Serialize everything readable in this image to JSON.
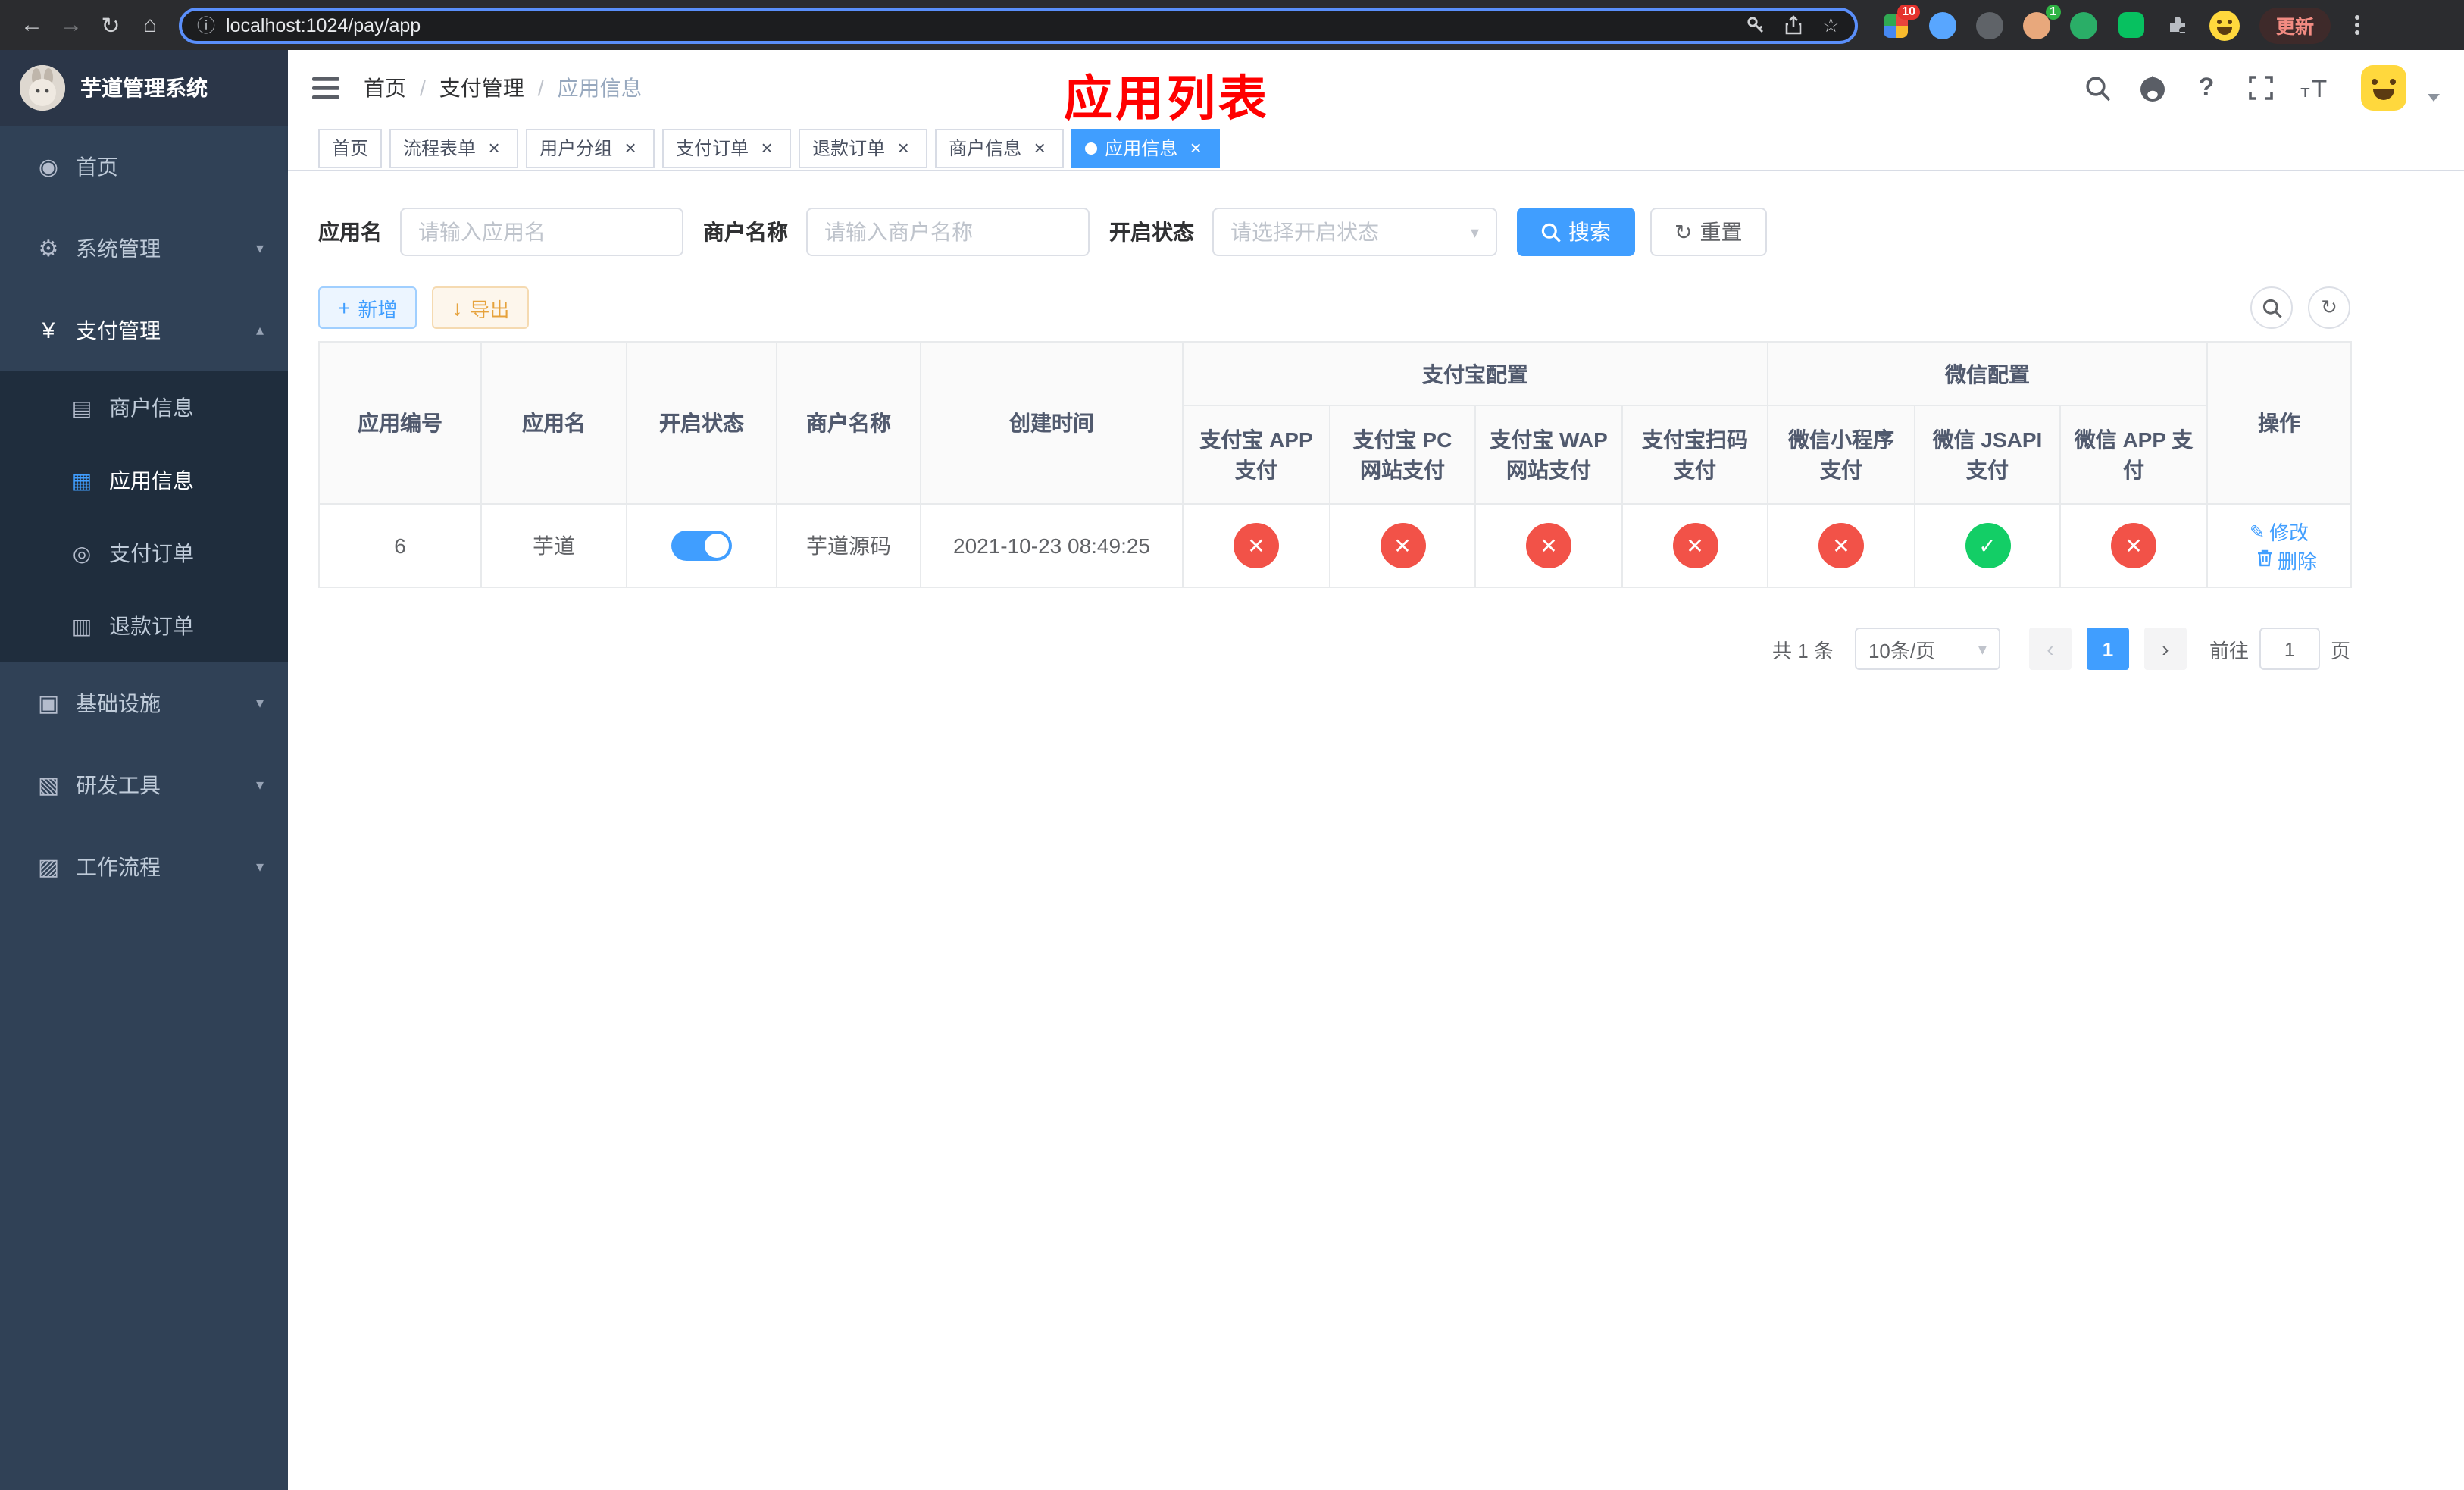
{
  "browser": {
    "url": "localhost:1024/pay/app",
    "update_label": "更新",
    "extensions_badge": "10",
    "profile_badge": "1"
  },
  "sidebar": {
    "title": "芋道管理系统",
    "menu": {
      "home": "首页",
      "system": "系统管理",
      "payment": "支付管理",
      "merchant_info": "商户信息",
      "app_info": "应用信息",
      "pay_order": "支付订单",
      "refund_order": "退款订单",
      "infrastructure": "基础设施",
      "dev_tools": "研发工具",
      "workflow": "工作流程"
    }
  },
  "navbar": {
    "breadcrumb": [
      "首页",
      "支付管理",
      "应用信息"
    ],
    "separator": "/",
    "annotation": "应用列表"
  },
  "tabs": [
    {
      "label": "首页"
    },
    {
      "label": "流程表单"
    },
    {
      "label": "用户分组"
    },
    {
      "label": "支付订单"
    },
    {
      "label": "退款订单"
    },
    {
      "label": "商户信息"
    },
    {
      "label": "应用信息"
    }
  ],
  "filters": {
    "app_name": {
      "label": "应用名",
      "placeholder": "请输入应用名"
    },
    "merchant_name": {
      "label": "商户名称",
      "placeholder": "请输入商户名称"
    },
    "status": {
      "label": "开启状态",
      "placeholder": "请选择开启状态"
    },
    "search": "搜索",
    "reset": "重置"
  },
  "toolbar": {
    "add": "新增",
    "export": "导出"
  },
  "table": {
    "headers": {
      "app_id": "应用编号",
      "app_name": "应用名",
      "status": "开启状态",
      "merchant_name": "商户名称",
      "create_time": "创建时间",
      "alipay_group": "支付宝配置",
      "wechat_group": "微信配置",
      "alipay_app": "支付宝 APP 支付",
      "alipay_pc": "支付宝 PC 网站支付",
      "alipay_wap": "支付宝 WAP 网站支付",
      "alipay_qr": "支付宝扫码支付",
      "wechat_lite": "微信小程序支付",
      "wechat_jsapi": "微信 JSAPI 支付",
      "wechat_app": "微信 APP 支付",
      "actions": "操作"
    },
    "row": {
      "app_id": "6",
      "app_name": "芋道",
      "status_on": true,
      "merchant_name": "芋道源码",
      "create_time": "2021-10-23 08:49:25",
      "alipay_app": "disabled",
      "alipay_pc": "disabled",
      "alipay_wap": "disabled",
      "alipay_qr": "disabled",
      "wechat_lite": "disabled",
      "wechat_jsapi": "enabled",
      "wechat_app": "disabled",
      "edit": "修改",
      "delete": "删除"
    }
  },
  "pagination": {
    "total": "共 1 条",
    "page_size": "10条/页",
    "page": "1",
    "goto": "前往",
    "goto_value": "1",
    "unit": "页"
  },
  "icons": {
    "back": "←",
    "forward": "→",
    "reload": "↻",
    "home": "⌂",
    "info": "ⓘ",
    "star": "☆",
    "close": "×",
    "check": "✓",
    "cross": "✕",
    "plus": "+",
    "download": "↓",
    "refresh": "↻",
    "edit": "✎",
    "help": "?",
    "prev": "‹",
    "next": "›",
    "caret_down": "▾",
    "caret_up": "▴",
    "menu_home": "◉",
    "menu_system": "⚙",
    "menu_payment": "¥",
    "menu_merchant": "▤",
    "menu_app": "▦",
    "menu_pay_order": "◎",
    "menu_refund": "▥",
    "menu_infra": "▣",
    "menu_dev": "▧",
    "menu_flow": "▨"
  },
  "colors": {
    "primary": "#409eff",
    "success": "#13ce66",
    "danger": "#f25248",
    "warning": "#e6a23c",
    "annotation": "#ff0000",
    "sidebar_bg": "#304156",
    "submenu_bg": "#1f2d3d"
  }
}
